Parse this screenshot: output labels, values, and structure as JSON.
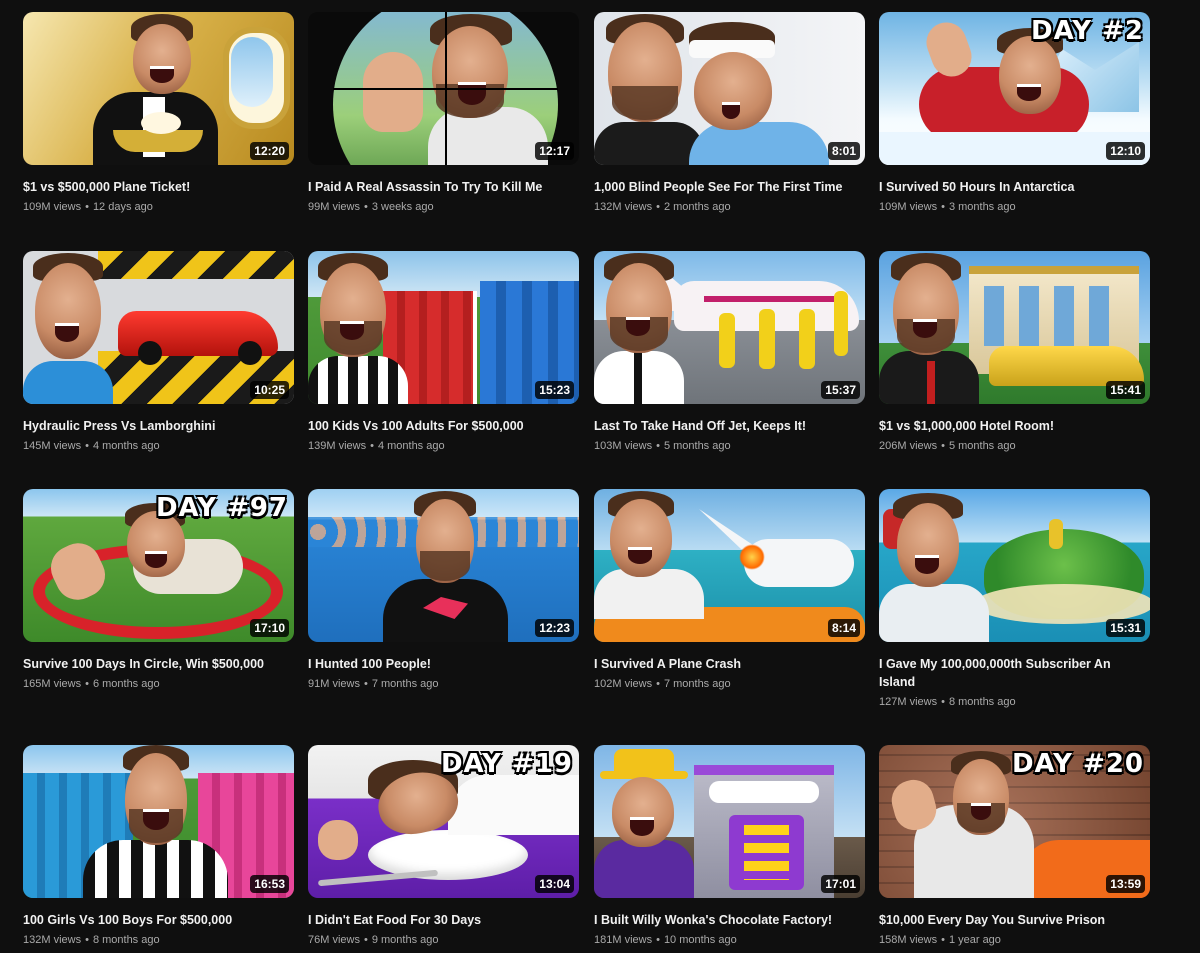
{
  "videos": [
    {
      "title": "$1 vs $500,000 Plane Ticket!",
      "views": "109M views",
      "age": "12 days ago",
      "duration": "12:20",
      "badge": ""
    },
    {
      "title": "I Paid A Real Assassin To Try To Kill Me",
      "views": "99M views",
      "age": "3 weeks ago",
      "duration": "12:17",
      "badge": ""
    },
    {
      "title": "1,000 Blind People See For The First Time",
      "views": "132M views",
      "age": "2 months ago",
      "duration": "8:01",
      "badge": ""
    },
    {
      "title": "I Survived 50 Hours In Antarctica",
      "views": "109M views",
      "age": "3 months ago",
      "duration": "12:10",
      "badge": "DAY #2"
    },
    {
      "title": "Hydraulic Press Vs Lamborghini",
      "views": "145M views",
      "age": "4 months ago",
      "duration": "10:25",
      "badge": ""
    },
    {
      "title": "100 Kids Vs 100 Adults For $500,000",
      "views": "139M views",
      "age": "4 months ago",
      "duration": "15:23",
      "badge": ""
    },
    {
      "title": "Last To Take Hand Off Jet, Keeps It!",
      "views": "103M views",
      "age": "5 months ago",
      "duration": "15:37",
      "badge": ""
    },
    {
      "title": "$1 vs $1,000,000 Hotel Room!",
      "views": "206M views",
      "age": "5 months ago",
      "duration": "15:41",
      "badge": ""
    },
    {
      "title": "Survive 100 Days In Circle, Win $500,000",
      "views": "165M views",
      "age": "6 months ago",
      "duration": "17:10",
      "badge": "DAY #97"
    },
    {
      "title": "I Hunted 100 People!",
      "views": "91M views",
      "age": "7 months ago",
      "duration": "12:23",
      "badge": ""
    },
    {
      "title": "I Survived A Plane Crash",
      "views": "102M views",
      "age": "7 months ago",
      "duration": "8:14",
      "badge": ""
    },
    {
      "title": "I Gave My 100,000,000th Subscriber An Island",
      "views": "127M views",
      "age": "8 months ago",
      "duration": "15:31",
      "badge": ""
    },
    {
      "title": "100 Girls Vs 100 Boys For $500,000",
      "views": "132M views",
      "age": "8 months ago",
      "duration": "16:53",
      "badge": ""
    },
    {
      "title": "I Didn't Eat Food For 30 Days",
      "views": "76M views",
      "age": "9 months ago",
      "duration": "13:04",
      "badge": "DAY #19"
    },
    {
      "title": "I Built Willy Wonka's Chocolate Factory!",
      "views": "181M views",
      "age": "10 months ago",
      "duration": "17:01",
      "badge": ""
    },
    {
      "title": "$10,000 Every Day You Survive Prison",
      "views": "158M views",
      "age": "1 year ago",
      "duration": "13:59",
      "badge": "DAY #20"
    }
  ],
  "meta_separator": "•"
}
